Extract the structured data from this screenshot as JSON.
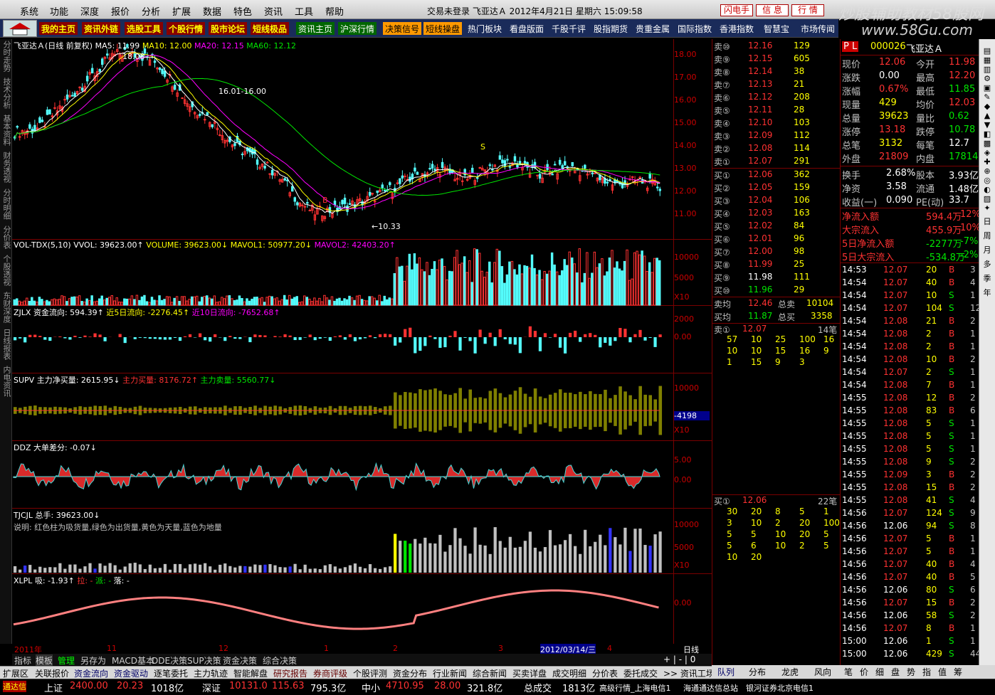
{
  "menu": [
    "系统",
    "功能",
    "深度",
    "报价",
    "分析",
    "扩展",
    "数据",
    "特色",
    "资讯",
    "工具",
    "帮助"
  ],
  "title": "交易未登录 飞亚达Ａ 2012年4月21日 星期六 15:09:58",
  "buttons": [
    "闪电手",
    "信 息",
    "行 情"
  ],
  "watermark": "炒股辅助教材58股网",
  "watermark2": "www.58Gu.com",
  "nav": [
    "我的主页",
    "资讯外链",
    "选股工具",
    "个股行情",
    "股市论坛",
    "短线极品",
    "资讯主页",
    "沪深行情",
    "决策信号",
    "短线操盘",
    "热门板块",
    "看盘版面",
    "千股千评",
    "股指期货",
    "贵重金属",
    "国际指数",
    "香港指数",
    "智慧宝",
    "市场传闻"
  ],
  "lefttabs": [
    "分时走势",
    "技术分析",
    "基本资料",
    "财务透视",
    "分时明细",
    "分价表",
    "个股透视",
    "东财深度",
    "日线报表",
    "内电资讯"
  ],
  "kline": {
    "label": "飞亚达Ａ(日线 前复权)",
    "ma5": "MA5: 11.99",
    "ma10": "MA10: 12.00",
    "ma20": "MA20: 12.15",
    "ma60": "MA60: 12.12",
    "scale": [
      "18.00",
      "17.00",
      "16.00",
      "15.00",
      "14.00",
      "13.00",
      "12.00",
      "11.00"
    ],
    "ann1": "18.08",
    "ann2": "16.01-16.00",
    "ann3": "←10.33",
    "s": "S",
    "b": "B"
  },
  "vol": {
    "label": "VOL-TDX(5,10)",
    "vvol": "VVOL: 39623.00↑",
    "volume": "VOLUME: 39623.00↓",
    "mavol1": "MAVOL1: 50977.20↓",
    "mavol2": "MAVOL2: 42403.20↑",
    "scale": [
      "10000",
      "5000",
      "X10"
    ]
  },
  "zjlx": {
    "label": "ZJLX",
    "a": "资金流向: 594.39↑",
    "b": "近5日流向: -2276.45↑",
    "c": "近10日流向: -7652.68↑",
    "scale": [
      "2000",
      "0.00"
    ]
  },
  "supv": {
    "label": "SUPV",
    "a": "主力净买量: 2615.95↓",
    "b": "主力买量: 8176.72↑",
    "c": "主力卖量: 5560.77↓",
    "scale": [
      "10000",
      "-4198",
      "X10"
    ]
  },
  "ddz": {
    "label": "DDZ",
    "a": "大单差分: -0.07↓",
    "scale": [
      "5.00",
      "0.00"
    ]
  },
  "tjcjl": {
    "label": "TJCJL",
    "a": "总手: 39623.00↓",
    "note": "说明: 红色柱为吸货量,绿色为出货量,黄色为天量,蓝色为地量",
    "scale": [
      "10000",
      "5000",
      "X10"
    ]
  },
  "xlpl": {
    "label": "XLPL",
    "a": "吸: -1.93↑",
    "b": "拉: -",
    "c": "派: -",
    "d": "落: -",
    "scale": [
      "0.00"
    ]
  },
  "xaxis": [
    "2011年",
    "11",
    "12",
    "1",
    "2",
    "3",
    "2012/03/14/三",
    "4",
    "日线"
  ],
  "bottomtabs": [
    "指标",
    "模板",
    "管理",
    "另存为",
    "MACD基本",
    "DDE决策",
    "SUP决策",
    "资金决策",
    "综合决策"
  ],
  "funcbar": [
    "扩展区",
    "关联报价",
    "资金流向",
    "资金驱动",
    "逐笔委托",
    "主力轨迹",
    "智能解盘",
    "研究报告",
    "券商评级",
    "个股评测",
    "资金分布",
    "行业新闻",
    "综合新闻",
    "买卖详盘",
    "成交明细",
    "分价表",
    "委托成交",
    ">> 资讯工场"
  ],
  "asks": [
    [
      "卖⑩",
      "12.16",
      "129"
    ],
    [
      "卖⑨",
      "12.15",
      "605"
    ],
    [
      "卖⑧",
      "12.14",
      "38"
    ],
    [
      "卖⑦",
      "12.13",
      "21"
    ],
    [
      "卖⑥",
      "12.12",
      "208"
    ],
    [
      "卖⑤",
      "12.11",
      "28"
    ],
    [
      "卖④",
      "12.10",
      "103"
    ],
    [
      "卖③",
      "12.09",
      "112"
    ],
    [
      "卖②",
      "12.08",
      "114"
    ],
    [
      "卖①",
      "12.07",
      "291"
    ]
  ],
  "bids": [
    [
      "买①",
      "12.06",
      "362"
    ],
    [
      "买②",
      "12.05",
      "159"
    ],
    [
      "买③",
      "12.04",
      "106"
    ],
    [
      "买④",
      "12.03",
      "163"
    ],
    [
      "买⑤",
      "12.02",
      "84"
    ],
    [
      "买⑥",
      "12.01",
      "96"
    ],
    [
      "买⑦",
      "12.00",
      "98"
    ],
    [
      "买⑧",
      "11.99",
      "25"
    ],
    [
      "买⑨",
      "11.98",
      "111"
    ],
    [
      "买⑩",
      "11.96",
      "29"
    ]
  ],
  "avg": {
    "ask_label": "卖均",
    "ask": "12.46",
    "ask_total_label": "总卖",
    "ask_total": "10104",
    "bid_label": "买均",
    "bid": "11.87",
    "bid_total_label": "总买",
    "bid_total": "3358"
  },
  "ask1q": {
    "label": "卖①",
    "price": "12.07",
    "count": "14笔",
    "rows": [
      [
        "57",
        "10",
        "25",
        "100",
        "16"
      ],
      [
        "10",
        "10",
        "15",
        "16",
        "9"
      ],
      [
        "1",
        "15",
        "9",
        "3",
        ""
      ]
    ]
  },
  "bid1q": {
    "label": "买①",
    "price": "12.06",
    "count": "22笔",
    "rows": [
      [
        "30",
        "20",
        "8",
        "5",
        "1"
      ],
      [
        "3",
        "10",
        "2",
        "20",
        "100"
      ],
      [
        "5",
        "5",
        "10",
        "20",
        "5"
      ],
      [
        "5",
        "6",
        "10",
        "2",
        "5"
      ],
      [
        "10",
        "20",
        "",
        "",
        ""
      ]
    ]
  },
  "stock": {
    "pl": "P L",
    "code": "000026",
    "name": "飞亚达Ａ"
  },
  "quote": [
    [
      "现价",
      "12.06",
      "今开",
      "11.98"
    ],
    [
      "涨跌",
      "0.00",
      "最高",
      "12.20"
    ],
    [
      "涨幅",
      "0.67%",
      "最低",
      "11.85"
    ],
    [
      "现量",
      "429",
      "均价",
      "12.03"
    ],
    [
      "总量",
      "39623",
      "量比",
      "0.62"
    ],
    [
      "涨停",
      "13.18",
      "跌停",
      "10.78"
    ],
    [
      "总笔",
      "3132",
      "每笔",
      "12.7"
    ],
    [
      "外盘",
      "21809",
      "内盘",
      "17814"
    ]
  ],
  "quote2": [
    [
      "换手",
      "2.68%",
      "股本",
      "3.93亿"
    ],
    [
      "净资",
      "3.58",
      "流通",
      "1.48亿"
    ],
    [
      "收益(一)",
      "0.090",
      "PE(动)",
      "33.7"
    ]
  ],
  "flow": [
    [
      "净流入额",
      "594.4万",
      "12%"
    ],
    [
      "大宗流入",
      "455.9万",
      "10%"
    ],
    [
      "5日净流入额",
      "-2277万",
      "-7%"
    ],
    [
      "5日大宗流入",
      "-534.8万",
      "-2%"
    ]
  ],
  "ticks": [
    [
      "14:53",
      "12.07",
      "20",
      "B",
      "3"
    ],
    [
      "14:54",
      "12.07",
      "40",
      "B",
      "4"
    ],
    [
      "14:54",
      "12.07",
      "10",
      "S",
      "1"
    ],
    [
      "14:54",
      "12.07",
      "104",
      "S",
      "12"
    ],
    [
      "14:54",
      "12.08",
      "21",
      "B",
      "2"
    ],
    [
      "14:54",
      "12.08",
      "2",
      "B",
      "1"
    ],
    [
      "14:54",
      "12.08",
      "2",
      "B",
      "1"
    ],
    [
      "14:54",
      "12.08",
      "10",
      "B",
      "2"
    ],
    [
      "14:54",
      "12.07",
      "2",
      "S",
      "1"
    ],
    [
      "14:54",
      "12.08",
      "7",
      "B",
      "1"
    ],
    [
      "14:55",
      "12.08",
      "12",
      "B",
      "2"
    ],
    [
      "14:55",
      "12.08",
      "83",
      "B",
      "6"
    ],
    [
      "14:55",
      "12.08",
      "5",
      "S",
      "1"
    ],
    [
      "14:55",
      "12.08",
      "5",
      "S",
      "1"
    ],
    [
      "14:55",
      "12.08",
      "5",
      "S",
      "1"
    ],
    [
      "14:55",
      "12.08",
      "9",
      "S",
      "2"
    ],
    [
      "14:55",
      "12.09",
      "3",
      "B",
      "2"
    ],
    [
      "14:55",
      "12.08",
      "15",
      "B",
      "2"
    ],
    [
      "14:55",
      "12.08",
      "41",
      "S",
      "4"
    ],
    [
      "14:56",
      "12.07",
      "124",
      "S",
      "9"
    ],
    [
      "14:56",
      "12.06",
      "94",
      "S",
      "8"
    ],
    [
      "14:56",
      "12.07",
      "5",
      "B",
      "1"
    ],
    [
      "14:56",
      "12.07",
      "5",
      "B",
      "1"
    ],
    [
      "14:56",
      "12.07",
      "40",
      "B",
      "4"
    ],
    [
      "14:56",
      "12.07",
      "40",
      "B",
      "5"
    ],
    [
      "14:56",
      "12.06",
      "80",
      "S",
      "6"
    ],
    [
      "14:56",
      "12.07",
      "15",
      "B",
      "2"
    ],
    [
      "14:56",
      "12.06",
      "58",
      "S",
      "2"
    ],
    [
      "14:56",
      "12.07",
      "8",
      "B",
      "1"
    ],
    [
      "15:00",
      "12.06",
      "1",
      "S",
      "1"
    ],
    [
      "15:00",
      "12.06",
      "429",
      "S",
      "44"
    ]
  ],
  "rightbar": [
    "日",
    "周",
    "月",
    "多",
    "季",
    "年"
  ],
  "qtabs": [
    "队列",
    "分布",
    "龙虎",
    "风向",
    "笔",
    "价",
    "细",
    "盘",
    "势",
    "指",
    "值",
    "筹"
  ],
  "status": {
    "a": "通达信",
    "b": "上证",
    "c": "2400.00",
    "d": "20.23",
    "e": "1018亿",
    "f": "深证",
    "g": "10131.0",
    "h": "115.63",
    "i": "795.3亿",
    "j": "中小",
    "k": "4710.95",
    "l": "28.00",
    "m": "321.8亿",
    "n": "总成交",
    "o": "1813亿",
    "p": "高级行情_上海电信1",
    "q": "海通通达信总站",
    "r": "银河证券北京电信1"
  }
}
